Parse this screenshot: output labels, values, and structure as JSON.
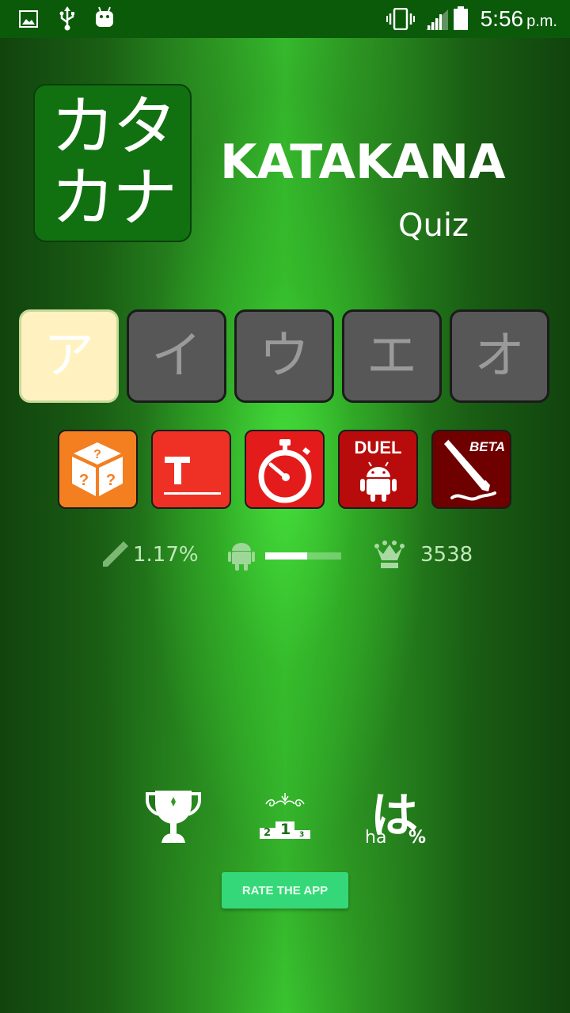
{
  "status_bar": {
    "time": "5:56",
    "ampm": "p.m.",
    "left_icons": [
      "image-icon",
      "usb-icon",
      "android-debug-icon"
    ],
    "right_icons": [
      "vibrate-icon",
      "signal-icon",
      "battery-icon"
    ]
  },
  "header": {
    "logo_line1": "カタ",
    "logo_line2": "カナ",
    "title": "KATAKANA",
    "subtitle": "Quiz"
  },
  "kana_tabs": [
    {
      "label": "ア",
      "active": true
    },
    {
      "label": "イ",
      "active": false
    },
    {
      "label": "ウ",
      "active": false
    },
    {
      "label": "エ",
      "active": false
    },
    {
      "label": "オ",
      "active": false
    }
  ],
  "modes": [
    {
      "name": "random",
      "icon": "question-dice-icon",
      "color": "#f37f21"
    },
    {
      "name": "typing",
      "icon": "text-input-icon",
      "color": "#ee3124"
    },
    {
      "name": "timed",
      "icon": "stopwatch-icon",
      "color": "#e41b1b"
    },
    {
      "name": "duel",
      "label": "DUEL",
      "icon": "android-icon",
      "color": "#b80c0c"
    },
    {
      "name": "writing",
      "label": "BETA",
      "icon": "pen-icon",
      "color": "#6e0000"
    }
  ],
  "stats": {
    "writing_percent": "1.17%",
    "android_progress_percent": 55,
    "crown_score": "3538"
  },
  "bottom": {
    "icons": [
      "trophy-icon",
      "leaderboard-podium-icon",
      "hiragana-percent-icon"
    ],
    "podium_labels": [
      "2",
      "1",
      "3"
    ],
    "hiragana_char": "は",
    "hiragana_romaji": "ha",
    "hiragana_percent": "%",
    "rate_button": "RATE THE APP"
  }
}
